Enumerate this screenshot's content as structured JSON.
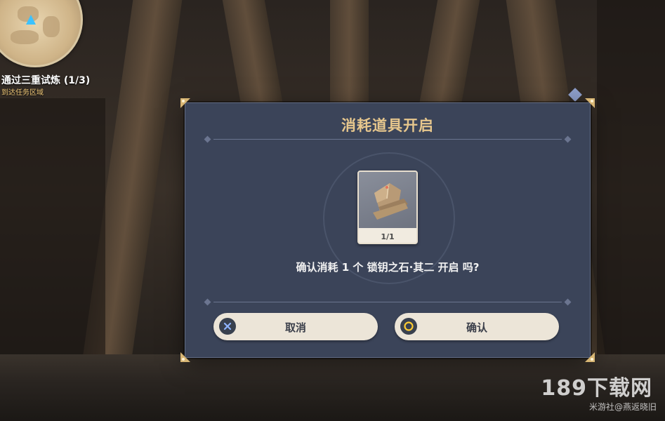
{
  "hud": {
    "quest_title": "通过三重试炼 (1/3)",
    "quest_subtitle": "到达任务区域"
  },
  "dialog": {
    "title": "消耗道具开启",
    "item": {
      "icon": "key-stone-icon",
      "count": "1/1"
    },
    "confirm_text": "确认消耗 1 个 锁钥之石·其二 开启 吗?",
    "buttons": {
      "cancel_label": "取消",
      "cancel_icon": "cross-button-icon",
      "confirm_label": "确认",
      "confirm_icon": "circle-button-icon"
    }
  },
  "watermark": {
    "site": "189下载网",
    "author": "米游社@燕返晓旧"
  },
  "colors": {
    "dialog_bg": "#3b4459",
    "title_gold": "#e7c78d",
    "button_bg": "#ece5d8"
  }
}
